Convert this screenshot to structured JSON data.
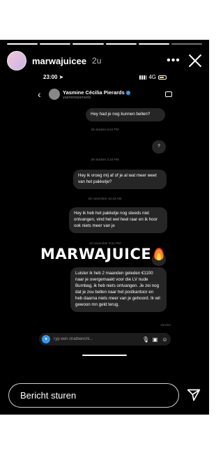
{
  "story": {
    "username": "marwajuicee",
    "time_ago": "2u",
    "more_label": "•••",
    "progress_total": 6,
    "progress_done": 5
  },
  "screenshot": {
    "status_time": "23:00",
    "status_network": "4G",
    "chat_name": "Yasmine Cécilia Pierards",
    "chat_handle": "yasminepierards",
    "messages": [
      {
        "text": "Hey had je nog kunnen bellen?"
      },
      {
        "text": "?"
      },
      {
        "text": "Hey ik vroeg mij af of je al wat meer weet van het pakketje?"
      },
      {
        "text": "Hey ik heb het pakketje nog steeds niet ontvangen, vind het wel heel raar en ik hoor ook niets meer van je"
      },
      {
        "text": "?"
      },
      {
        "text": "Luister ik heb 2 maanden geleden €1100 naar je overgemaakt voor die LV nude Bumbag, ik heb niets ontvangen.  Je zei nog dat je zou bellen naar het postkantoor en heb daarna niets meer van je gehoord. Ik wil gewoon mn geld terug."
      }
    ],
    "timestamps": [
      "28 oktober 6:04 PM",
      "28 oktober 2:18 PM",
      "02 november 10:43 AM",
      "12 november 9:21 PM"
    ],
    "seen_label": "Gezien",
    "composer_placeholder": "Typ een chatbericht..."
  },
  "sticker_text": "MARWAJUICE",
  "reply": {
    "placeholder": "Bericht sturen"
  },
  "icons": {
    "close": "close-icon",
    "send": "send-icon",
    "camera": "camera-icon",
    "fire": "fire-icon"
  },
  "colors": {
    "background": "#000000",
    "bubble": "#262626",
    "accent": "#3897f0"
  }
}
